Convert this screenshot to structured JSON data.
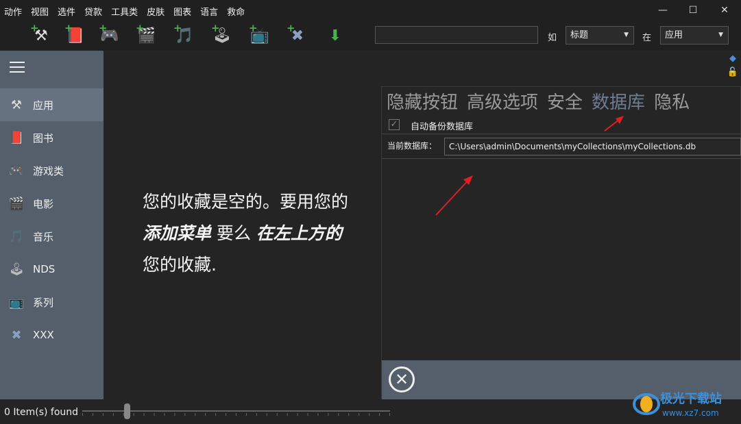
{
  "menu": [
    "动作",
    "视图",
    "选件",
    "贷款",
    "工具类",
    "皮肤",
    "图表",
    "语言",
    "救命"
  ],
  "window_controls": {
    "minimize": "—",
    "maximize": "☐",
    "close": "✕"
  },
  "toolbar": {
    "tools": [
      {
        "name": "apps-add-tool",
        "glyph": "⚒"
      },
      {
        "name": "books-add-tool",
        "glyph": "📕"
      },
      {
        "name": "games-add-tool",
        "glyph": "🎮"
      },
      {
        "name": "movies-add-tool",
        "glyph": "🎬"
      },
      {
        "name": "music-add-tool",
        "glyph": "🎵"
      },
      {
        "name": "nds-add-tool",
        "glyph": "🕹"
      },
      {
        "name": "series-add-tool",
        "glyph": "📺"
      },
      {
        "name": "xxx-add-tool",
        "glyph": "✖"
      },
      {
        "name": "download-tool",
        "glyph": "⬇"
      }
    ],
    "search_value": "",
    "by_label": "如",
    "by_value": "标题",
    "in_label": "在",
    "in_value": "应用"
  },
  "sidebar": {
    "items": [
      {
        "label": "应用",
        "icon": "⚒",
        "active": true
      },
      {
        "label": "图书",
        "icon": "📕",
        "active": false
      },
      {
        "label": "游戏类",
        "icon": "🎮",
        "active": false
      },
      {
        "label": "电影",
        "icon": "🎬",
        "active": false
      },
      {
        "label": "音乐",
        "icon": "🎵",
        "active": false
      },
      {
        "label": "NDS",
        "icon": "🕹",
        "active": false
      },
      {
        "label": "系列",
        "icon": "📺",
        "active": false
      },
      {
        "label": "XXX",
        "icon": "✖",
        "active": false
      }
    ]
  },
  "empty_message": {
    "line1": "您的收藏是空的。要用您的",
    "line2_bold1": "添加菜单",
    "line2_mid": " 要么 ",
    "line2_bold2": "在左上方的",
    "line3": "您的收藏."
  },
  "status": {
    "found": "0 Item(s) found"
  },
  "panel": {
    "tabs": [
      "隐藏按钮",
      "高级选项",
      "安全",
      "数据库",
      "隐私"
    ],
    "active_tab": "数据库",
    "auto_backup_label": "自动备份数据库",
    "auto_backup_checked": true,
    "db_label": "当前数据库：",
    "db_path": "C:\\Users\\admin\\Documents\\myCollections\\myCollections.db",
    "close_glyph": "✕"
  },
  "watermark": {
    "text": "极光下载站",
    "url": "www.xz7.com"
  },
  "colors": {
    "sidebar": "#545f6b",
    "active_item": "#667280",
    "active_tab": "#6f7d93",
    "arrow": "#e02020"
  }
}
